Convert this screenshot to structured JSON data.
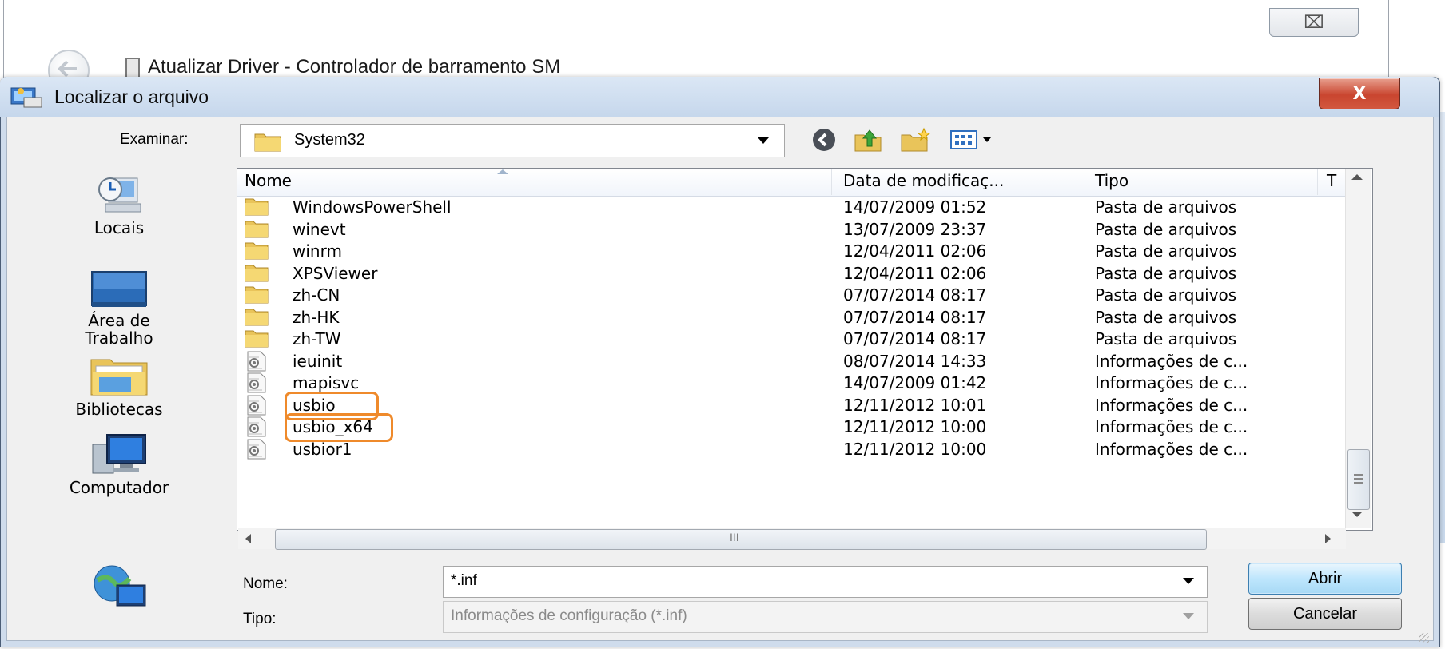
{
  "background_window": {
    "title": "Atualizar Driver -  Controlador de barramento SM",
    "close_glyph": "⌧"
  },
  "dialog": {
    "title": "Localizar o arquivo",
    "close_glyph": "X"
  },
  "look_in": {
    "label": "Examinar:",
    "value": "System32"
  },
  "toolbar": {
    "back_icon": "back-icon",
    "up_icon": "up-folder-icon",
    "new_folder_icon": "new-folder-icon",
    "views_icon": "views-menu-icon"
  },
  "places": [
    {
      "label": "Locais",
      "icon": "recent-places-icon"
    },
    {
      "label": "Área de Trabalho",
      "icon": "desktop-icon"
    },
    {
      "label": "Bibliotecas",
      "icon": "libraries-icon"
    },
    {
      "label": "Computador",
      "icon": "computer-icon"
    },
    {
      "label": "",
      "icon": "network-icon"
    }
  ],
  "columns": {
    "name": "Nome",
    "date": "Data de modificaç...",
    "type": "Tipo",
    "size": "T"
  },
  "files": [
    {
      "name": "WindowsPowerShell",
      "date": "14/07/2009 01:52",
      "type": "Pasta de arquivos",
      "kind": "folder"
    },
    {
      "name": "winevt",
      "date": "13/07/2009 23:37",
      "type": "Pasta de arquivos",
      "kind": "folder"
    },
    {
      "name": "winrm",
      "date": "12/04/2011 02:06",
      "type": "Pasta de arquivos",
      "kind": "folder"
    },
    {
      "name": "XPSViewer",
      "date": "12/04/2011 02:06",
      "type": "Pasta de arquivos",
      "kind": "folder"
    },
    {
      "name": "zh-CN",
      "date": "07/07/2014 08:17",
      "type": "Pasta de arquivos",
      "kind": "folder"
    },
    {
      "name": "zh-HK",
      "date": "07/07/2014 08:17",
      "type": "Pasta de arquivos",
      "kind": "folder"
    },
    {
      "name": "zh-TW",
      "date": "07/07/2014 08:17",
      "type": "Pasta de arquivos",
      "kind": "folder"
    },
    {
      "name": "ieuinit",
      "date": "08/07/2014 14:33",
      "type": "Informações de c...",
      "kind": "inf"
    },
    {
      "name": "mapisvc",
      "date": "14/07/2009 01:42",
      "type": "Informações de c...",
      "kind": "inf"
    },
    {
      "name": "usbio",
      "date": "12/11/2012 10:01",
      "type": "Informações de c...",
      "kind": "inf",
      "highlighted": true
    },
    {
      "name": "usbio_x64",
      "date": "12/11/2012 10:00",
      "type": "Informações de c...",
      "kind": "inf",
      "highlighted": true
    },
    {
      "name": "usbior1",
      "date": "12/11/2012 10:00",
      "type": "Informações de c...",
      "kind": "inf"
    }
  ],
  "hscroll_grip": "III",
  "filename": {
    "label": "Nome:",
    "value": "*.inf"
  },
  "filetype": {
    "label": "Tipo:",
    "value": "Informações de configuração (*.inf)"
  },
  "buttons": {
    "open": "Abrir",
    "cancel": "Cancelar"
  },
  "colors": {
    "highlight": "#ef8a2b",
    "close_red": "#c9452f",
    "title_bar": "#c6d7ec",
    "folder": "#e9c45a"
  }
}
